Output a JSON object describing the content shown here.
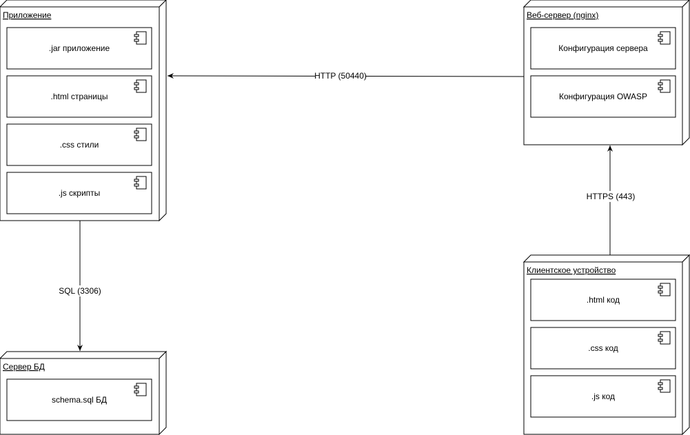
{
  "nodes": {
    "app": {
      "title": "Приложение",
      "components": [
        ".jar приложение",
        ".html страницы",
        ".css стили",
        ".js скрипты"
      ]
    },
    "web": {
      "title": "Веб-сервер (nginx)",
      "components": [
        "Конфигурация сервера",
        "Конфигурация OWASP"
      ]
    },
    "db": {
      "title": "Сервер БД",
      "components": [
        "schema.sql БД"
      ]
    },
    "client": {
      "title": "Клиентское устройство",
      "components": [
        ".html код",
        ".css код",
        ".js код"
      ]
    }
  },
  "edges": {
    "http": "HTTP (50440)",
    "https": "HTTPS (443)",
    "sql": "SQL (3306)"
  }
}
